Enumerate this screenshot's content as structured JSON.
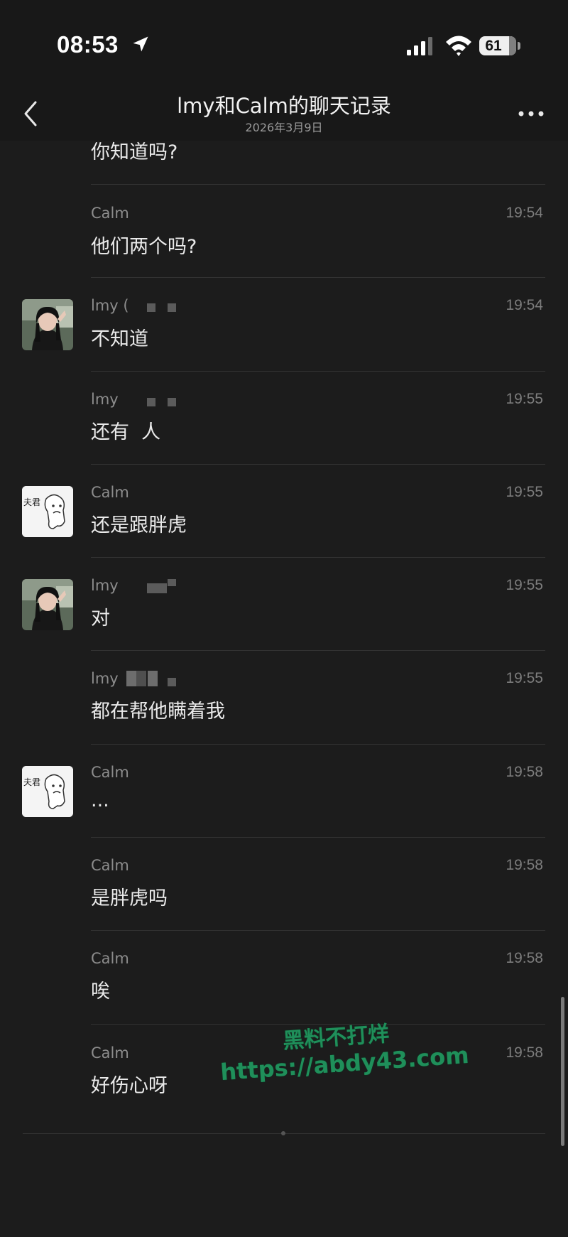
{
  "status_bar": {
    "time": "08:53",
    "battery_level": "61",
    "icons": [
      "location-arrow-icon",
      "cellular-signal-icon",
      "wifi-icon",
      "battery-icon"
    ]
  },
  "nav": {
    "title": "lmy和Calm的聊天记录",
    "date": "2026年3月9日",
    "back_icon": "chevron-left-icon",
    "more_icon": "more-dots-icon"
  },
  "messages": [
    {
      "sender": "",
      "time": "",
      "text": "你知道吗?",
      "avatar": ""
    },
    {
      "sender": "Calm",
      "time": "19:54",
      "text": "他们两个吗?",
      "avatar": ""
    },
    {
      "sender": "lmy (",
      "time": "19:54",
      "text": "不知道",
      "avatar": "girl-photo"
    },
    {
      "sender": "lmy",
      "time": "19:55",
      "text": "还有  人",
      "avatar": ""
    },
    {
      "sender": "Calm",
      "time": "19:55",
      "text": "还是跟胖虎",
      "avatar": "cartoon-sticker"
    },
    {
      "sender": "lmy",
      "time": "19:55",
      "text": "对",
      "avatar": "girl-photo"
    },
    {
      "sender": "lmy",
      "time": "19:55",
      "text": "都在帮他瞒着我",
      "avatar": ""
    },
    {
      "sender": "Calm",
      "time": "19:58",
      "text": "...",
      "avatar": "cartoon-sticker"
    },
    {
      "sender": "Calm",
      "time": "19:58",
      "text": "是胖虎吗",
      "avatar": ""
    },
    {
      "sender": "Calm",
      "time": "19:58",
      "text": "唉",
      "avatar": ""
    },
    {
      "sender": "Calm",
      "time": "19:58",
      "text": "好伤心呀",
      "avatar": ""
    }
  ],
  "sticker_text": "夫君",
  "watermark": {
    "line1": "黑料不打烊",
    "line2": "https://abdy43.com"
  },
  "colors": {
    "background": "#1c1c1c",
    "header": "#181818",
    "watermark": "#1f8f5a"
  }
}
